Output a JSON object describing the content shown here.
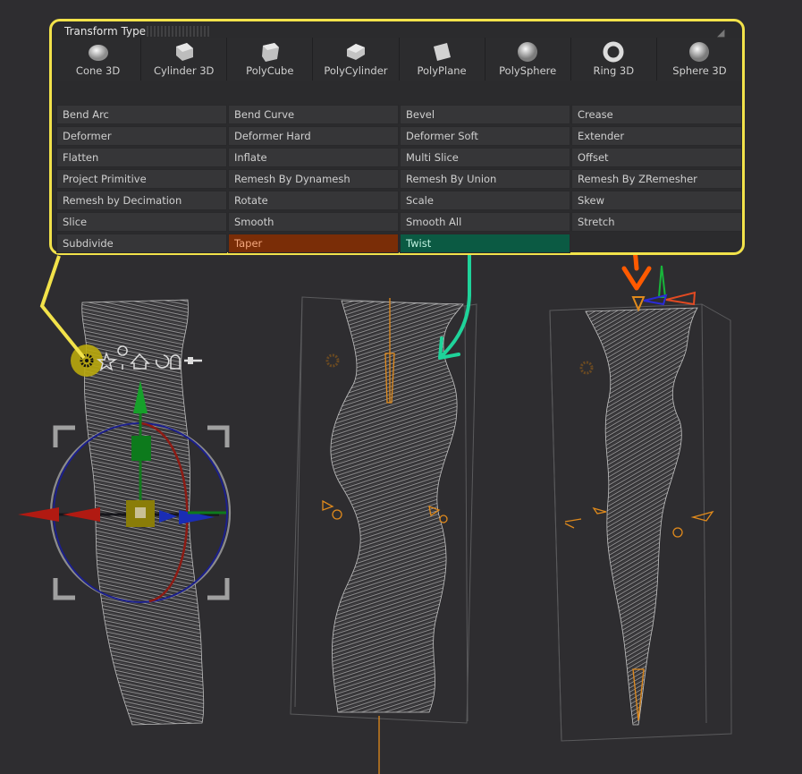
{
  "panel": {
    "title": "Transform Type",
    "primitives": [
      {
        "label": "Cone 3D",
        "icon": "cone-3d-icon"
      },
      {
        "label": "Cylinder 3D",
        "icon": "cylinder-3d-icon"
      },
      {
        "label": "PolyCube",
        "icon": "polycube-icon"
      },
      {
        "label": "PolyCylinder",
        "icon": "polycylinder-icon"
      },
      {
        "label": "PolyPlane",
        "icon": "polyplane-icon"
      },
      {
        "label": "PolySphere",
        "icon": "polysphere-icon"
      },
      {
        "label": "Ring 3D",
        "icon": "ring-3d-icon"
      },
      {
        "label": "Sphere 3D",
        "icon": "sphere-3d-icon"
      }
    ],
    "deformers": [
      "Bend Arc",
      "Bend Curve",
      "Bevel",
      "Crease",
      "Deformer",
      "Deformer Hard",
      "Deformer Soft",
      "Extender",
      "Flatten",
      "Inflate",
      "Multi Slice",
      "Offset",
      "Project Primitive",
      "Remesh By Dynamesh",
      "Remesh By Union",
      "Remesh By ZRemesher",
      "Remesh by Decimation",
      "Rotate",
      "Scale",
      "Skew",
      "Slice",
      "Smooth",
      "Smooth All",
      "Stretch",
      "Subdivide",
      "Taper",
      "Twist",
      ""
    ],
    "highlighted": {
      "Taper": "#7a2d07",
      "Twist": "#0b5a43"
    }
  },
  "colors": {
    "callout_yellow": "#f2e24a",
    "arrow_orange": "#ff5a00",
    "arrow_green": "#1fd39a",
    "gizmo_orange": "#e08a1c",
    "background": "#2e2d30"
  },
  "gizmo_toolbar_icons": [
    "gear-icon",
    "star-icon",
    "pin-icon",
    "home-icon",
    "rotate-icon",
    "lock-icon",
    "slider-icon"
  ]
}
